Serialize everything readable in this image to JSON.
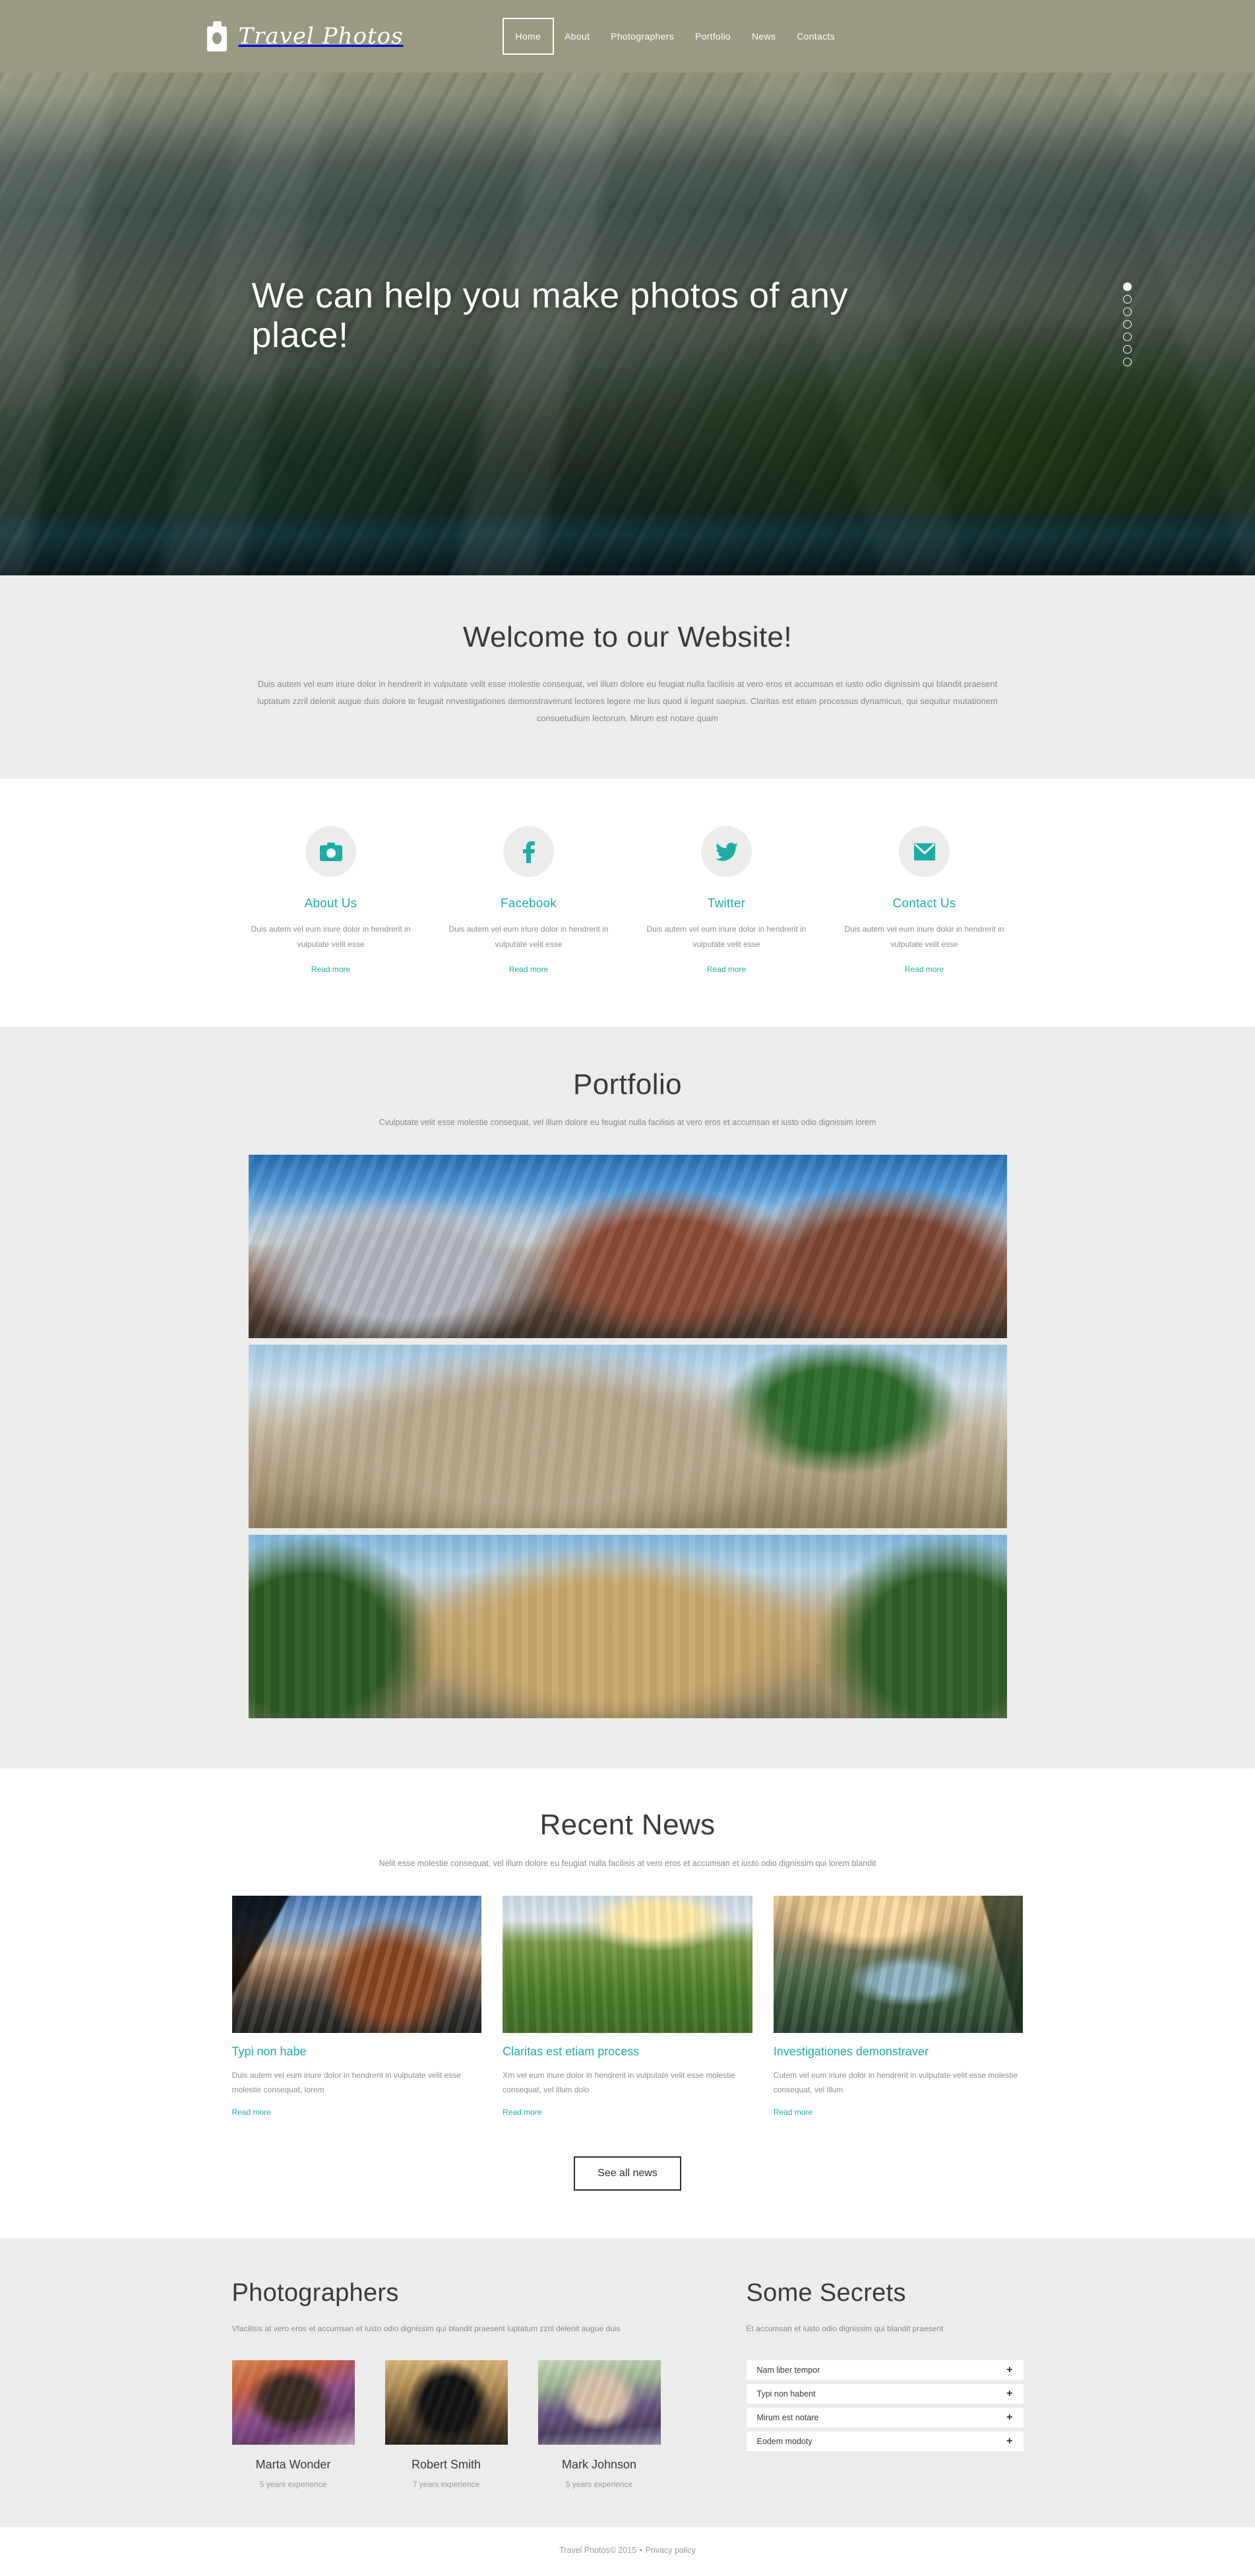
{
  "brand": {
    "name": "Travel Photos",
    "logo_icon": "camera-icon"
  },
  "nav": [
    {
      "label": "Home",
      "active": true
    },
    {
      "label": "About",
      "active": false
    },
    {
      "label": "Photographers",
      "active": false
    },
    {
      "label": "Portfolio",
      "active": false
    },
    {
      "label": "News",
      "active": false
    },
    {
      "label": "Contacts",
      "active": false
    }
  ],
  "hero": {
    "headline": "We can help you make photos of any place!",
    "slider_dots": 7,
    "active_dot": 1
  },
  "welcome": {
    "title": "Welcome to our Website!",
    "body": "Duis autem vel eum iriure dolor in hendrerit in vulputate velit esse molestie consequat, vel illum dolore eu feugiat nulla facilisis at vero eros et accumsan et iusto odio dignissim qui blandit praesent luptatum zzril delenit augue duis dolore te feugait nnvestigationes demonstraverunt lectores legere me lius quod ii legunt saepius. Claritas est etiam processus dynamicus, qui sequitur mutationem consuetudium lectorum. Mirum est notare quam"
  },
  "features": [
    {
      "icon": "camera-icon",
      "title": "About Us",
      "text": "Duis autem vel eum iriure dolor in hendrerit in vulputate velit esse",
      "link": "Read more"
    },
    {
      "icon": "facebook-icon",
      "title": "Facebook",
      "text": "Duis autem vel eum iriure dolor in hendrerit in vulputate velit esse",
      "link": "Read more"
    },
    {
      "icon": "twitter-icon",
      "title": "Twitter",
      "text": "Duis autem vel eum iriure dolor in hendrerit in vulputate velit esse",
      "link": "Read more"
    },
    {
      "icon": "envelope-icon",
      "title": "Contact Us",
      "text": "Duis autem vel eum iriure dolor in hendrerit in vulputate velit esse",
      "link": "Read more"
    }
  ],
  "portfolio": {
    "title": "Portfolio",
    "subtitle": "Cvulputate velit esse molestie consequat, vel illum dolore eu feugiat nulla facilisis at vero eros et accumsan et iusto odio dignissim lorem",
    "items": [
      {
        "alt": "snow-capped-mountain-range-photo"
      },
      {
        "alt": "wooden-boat-on-tropical-beach-photo"
      },
      {
        "alt": "roman-colosseum-amphitheatre-photo"
      }
    ]
  },
  "news": {
    "title": "Recent News",
    "subtitle": "Nelit esse molestie consequat, vel illum dolore eu feugiat nulla facilisis at vero eros et accumsan et iusto odio dignissim qui  lorem blandit",
    "cards": [
      {
        "alt": "rock-climber-at-sunset-photo",
        "title": "Typi non habe",
        "text": "Duis autem vel eum iriure dolor in hendrerit in vulputate velit esse molestie consequat, lorem",
        "link": "Read more"
      },
      {
        "alt": "green-field-path-at-sunrise-photo",
        "title": "Claritas est etiam process",
        "text": "Xm vel eum iriure dolor in hendrerit in vulputate velit esse molestie consequat, vel illum dolo",
        "link": "Read more"
      },
      {
        "alt": "mountain-lake-with-pine-trees-photo",
        "title": "Investigationes demonstraver",
        "text": "Cutem vel eum iriure dolor in hendrerit in vulputate velit esse molestie consequat, vel illum",
        "link": "Read more"
      }
    ],
    "see_all_label": "See all news"
  },
  "photographers": {
    "title": "Photographers",
    "subtitle": "Vfacilisis at vero eros et accumsan et iusto odio dignissim qui blandit praesent luptatum zzril delenit augue duis",
    "people": [
      {
        "alt": "woman-with-camera-portrait",
        "name": "Marta Wonder",
        "experience": "5 years experience"
      },
      {
        "alt": "silhouette-photographer-with-tripod",
        "name": "Robert Smith",
        "experience": "7 years experience"
      },
      {
        "alt": "man-holding-camera-portrait",
        "name": "Mark Johnson",
        "experience": "5 years experience"
      }
    ]
  },
  "secrets": {
    "title": "Some Secrets",
    "subtitle": "Et accumsan et iusto odio dignissim qui blandit praesent",
    "items": [
      {
        "label": "Nam liber tempor",
        "toggle": "+"
      },
      {
        "label": "Typi non habent",
        "toggle": "+"
      },
      {
        "label": "Mirum est notare",
        "toggle": "+"
      },
      {
        "label": "Eodem modoty",
        "toggle": "+"
      }
    ]
  },
  "footer": {
    "copyright": "Travel Photos© 2015",
    "separator": "•",
    "privacy": "Privacy policy"
  },
  "colors": {
    "accent": "#1bada6",
    "header_bg": "#9a9a82",
    "section_bg": "#ececea",
    "heading": "#3a3a3a",
    "body_text": "#8a8a88"
  }
}
